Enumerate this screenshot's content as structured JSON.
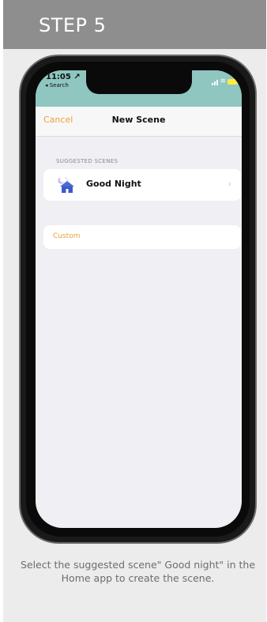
{
  "header": {
    "step_label": "STEP 5",
    "color": "#8e8e8e"
  },
  "status_bar": {
    "time": "11:05 ↗",
    "back_app": "◂ Search",
    "color": "#8fc6c0"
  },
  "navbar": {
    "cancel_label": "Cancel",
    "title": "New Scene",
    "accent": "#e8a23a"
  },
  "suggested": {
    "section_title": "SUGGESTED SCENES",
    "items": [
      {
        "label": "Good Night",
        "icon": "moon-house-icon"
      }
    ]
  },
  "custom": {
    "label": "Custom"
  },
  "caption": "Select the suggested scene\" Good night\" in the Home app to create the scene."
}
